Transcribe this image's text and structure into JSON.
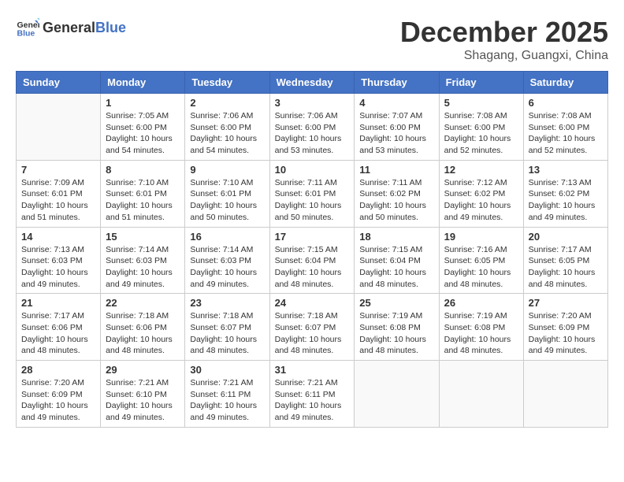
{
  "logo": {
    "general": "General",
    "blue": "Blue"
  },
  "title": {
    "month": "December 2025",
    "location": "Shagang, Guangxi, China"
  },
  "headers": [
    "Sunday",
    "Monday",
    "Tuesday",
    "Wednesday",
    "Thursday",
    "Friday",
    "Saturday"
  ],
  "weeks": [
    [
      {
        "day": "",
        "info": ""
      },
      {
        "day": "1",
        "info": "Sunrise: 7:05 AM\nSunset: 6:00 PM\nDaylight: 10 hours and 54 minutes."
      },
      {
        "day": "2",
        "info": "Sunrise: 7:06 AM\nSunset: 6:00 PM\nDaylight: 10 hours and 54 minutes."
      },
      {
        "day": "3",
        "info": "Sunrise: 7:06 AM\nSunset: 6:00 PM\nDaylight: 10 hours and 53 minutes."
      },
      {
        "day": "4",
        "info": "Sunrise: 7:07 AM\nSunset: 6:00 PM\nDaylight: 10 hours and 53 minutes."
      },
      {
        "day": "5",
        "info": "Sunrise: 7:08 AM\nSunset: 6:00 PM\nDaylight: 10 hours and 52 minutes."
      },
      {
        "day": "6",
        "info": "Sunrise: 7:08 AM\nSunset: 6:00 PM\nDaylight: 10 hours and 52 minutes."
      }
    ],
    [
      {
        "day": "7",
        "info": "Sunrise: 7:09 AM\nSunset: 6:01 PM\nDaylight: 10 hours and 51 minutes."
      },
      {
        "day": "8",
        "info": "Sunrise: 7:10 AM\nSunset: 6:01 PM\nDaylight: 10 hours and 51 minutes."
      },
      {
        "day": "9",
        "info": "Sunrise: 7:10 AM\nSunset: 6:01 PM\nDaylight: 10 hours and 50 minutes."
      },
      {
        "day": "10",
        "info": "Sunrise: 7:11 AM\nSunset: 6:01 PM\nDaylight: 10 hours and 50 minutes."
      },
      {
        "day": "11",
        "info": "Sunrise: 7:11 AM\nSunset: 6:02 PM\nDaylight: 10 hours and 50 minutes."
      },
      {
        "day": "12",
        "info": "Sunrise: 7:12 AM\nSunset: 6:02 PM\nDaylight: 10 hours and 49 minutes."
      },
      {
        "day": "13",
        "info": "Sunrise: 7:13 AM\nSunset: 6:02 PM\nDaylight: 10 hours and 49 minutes."
      }
    ],
    [
      {
        "day": "14",
        "info": "Sunrise: 7:13 AM\nSunset: 6:03 PM\nDaylight: 10 hours and 49 minutes."
      },
      {
        "day": "15",
        "info": "Sunrise: 7:14 AM\nSunset: 6:03 PM\nDaylight: 10 hours and 49 minutes."
      },
      {
        "day": "16",
        "info": "Sunrise: 7:14 AM\nSunset: 6:03 PM\nDaylight: 10 hours and 49 minutes."
      },
      {
        "day": "17",
        "info": "Sunrise: 7:15 AM\nSunset: 6:04 PM\nDaylight: 10 hours and 48 minutes."
      },
      {
        "day": "18",
        "info": "Sunrise: 7:15 AM\nSunset: 6:04 PM\nDaylight: 10 hours and 48 minutes."
      },
      {
        "day": "19",
        "info": "Sunrise: 7:16 AM\nSunset: 6:05 PM\nDaylight: 10 hours and 48 minutes."
      },
      {
        "day": "20",
        "info": "Sunrise: 7:17 AM\nSunset: 6:05 PM\nDaylight: 10 hours and 48 minutes."
      }
    ],
    [
      {
        "day": "21",
        "info": "Sunrise: 7:17 AM\nSunset: 6:06 PM\nDaylight: 10 hours and 48 minutes."
      },
      {
        "day": "22",
        "info": "Sunrise: 7:18 AM\nSunset: 6:06 PM\nDaylight: 10 hours and 48 minutes."
      },
      {
        "day": "23",
        "info": "Sunrise: 7:18 AM\nSunset: 6:07 PM\nDaylight: 10 hours and 48 minutes."
      },
      {
        "day": "24",
        "info": "Sunrise: 7:18 AM\nSunset: 6:07 PM\nDaylight: 10 hours and 48 minutes."
      },
      {
        "day": "25",
        "info": "Sunrise: 7:19 AM\nSunset: 6:08 PM\nDaylight: 10 hours and 48 minutes."
      },
      {
        "day": "26",
        "info": "Sunrise: 7:19 AM\nSunset: 6:08 PM\nDaylight: 10 hours and 48 minutes."
      },
      {
        "day": "27",
        "info": "Sunrise: 7:20 AM\nSunset: 6:09 PM\nDaylight: 10 hours and 49 minutes."
      }
    ],
    [
      {
        "day": "28",
        "info": "Sunrise: 7:20 AM\nSunset: 6:09 PM\nDaylight: 10 hours and 49 minutes."
      },
      {
        "day": "29",
        "info": "Sunrise: 7:21 AM\nSunset: 6:10 PM\nDaylight: 10 hours and 49 minutes."
      },
      {
        "day": "30",
        "info": "Sunrise: 7:21 AM\nSunset: 6:11 PM\nDaylight: 10 hours and 49 minutes."
      },
      {
        "day": "31",
        "info": "Sunrise: 7:21 AM\nSunset: 6:11 PM\nDaylight: 10 hours and 49 minutes."
      },
      {
        "day": "",
        "info": ""
      },
      {
        "day": "",
        "info": ""
      },
      {
        "day": "",
        "info": ""
      }
    ]
  ]
}
